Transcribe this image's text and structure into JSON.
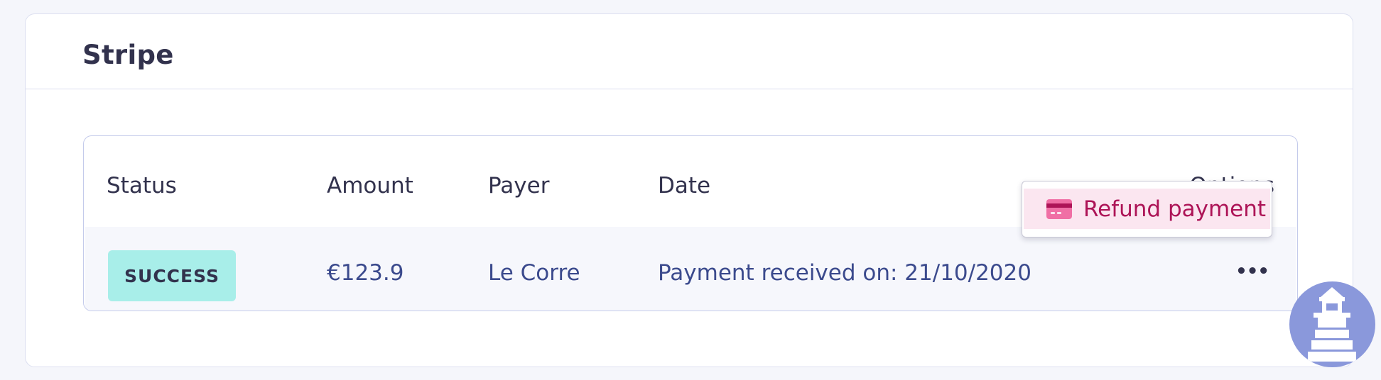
{
  "section": {
    "title": "Stripe"
  },
  "table": {
    "columns": [
      "Status",
      "Amount",
      "Payer",
      "Date",
      "Options"
    ],
    "rows": [
      {
        "status": "SUCCESS",
        "amount": "€123.9",
        "payer": "Le Corre",
        "date": "Payment received on: 21/10/2020",
        "options_icon": "ellipsis-icon"
      }
    ]
  },
  "options_menu": {
    "items": [
      {
        "label": "Refund payment",
        "icon": "credit-card-icon"
      }
    ]
  },
  "colors": {
    "success_badge": "#a8eee9",
    "refund_text": "#ad1457",
    "refund_bg": "#fbe6f0",
    "value_text": "#3b4a8d",
    "help_button": "#8a98db"
  },
  "help_widget": {
    "icon": "lighthouse-icon"
  }
}
